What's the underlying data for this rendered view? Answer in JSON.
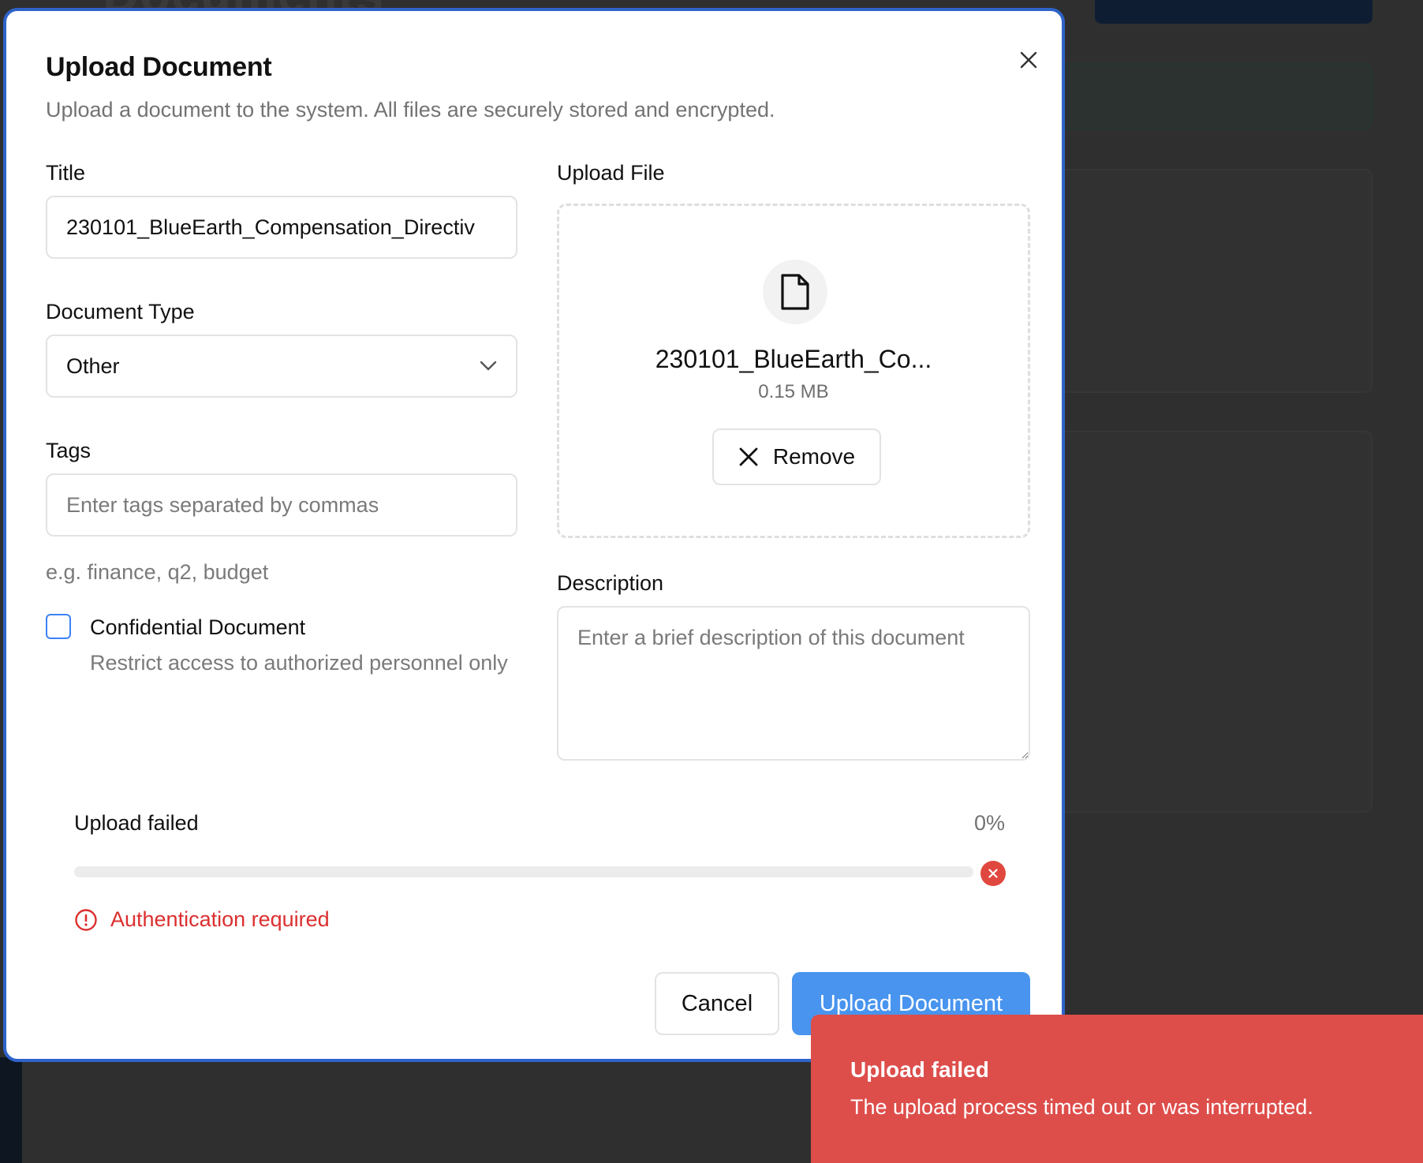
{
  "background": {
    "page_title": "Documents"
  },
  "modal": {
    "title": "Upload Document",
    "description": "Upload a document to the system. All files are securely stored and encrypted.",
    "fields": {
      "title_label": "Title",
      "title_value": "230101_BlueEarth_Compensation_Directiv",
      "doc_type_label": "Document Type",
      "doc_type_value": "Other",
      "tags_label": "Tags",
      "tags_placeholder": "Enter tags separated by commas",
      "tags_hint": "e.g. finance, q2, budget",
      "confidential_label": "Confidential Document",
      "confidential_desc": "Restrict access to authorized personnel only",
      "confidential_checked": false,
      "upload_file_label": "Upload File",
      "description_label": "Description",
      "description_placeholder": "Enter a brief description of this document"
    },
    "file": {
      "name": "230101_BlueEarth_Co...",
      "size": "0.15 MB",
      "remove_label": "Remove",
      "icon": "file-icon"
    },
    "progress": {
      "status": "Upload failed",
      "percent_label": "0%",
      "percent": 0,
      "error": "Authentication required"
    },
    "buttons": {
      "cancel": "Cancel",
      "upload": "Upload Document"
    }
  },
  "toast": {
    "title": "Upload failed",
    "message": "The upload process timed out or was interrupted."
  },
  "colors": {
    "accent": "#4894ee",
    "modal_border": "#2f63c9",
    "error": "#dc2f2f",
    "toast_bg": "#dd4e4b"
  }
}
